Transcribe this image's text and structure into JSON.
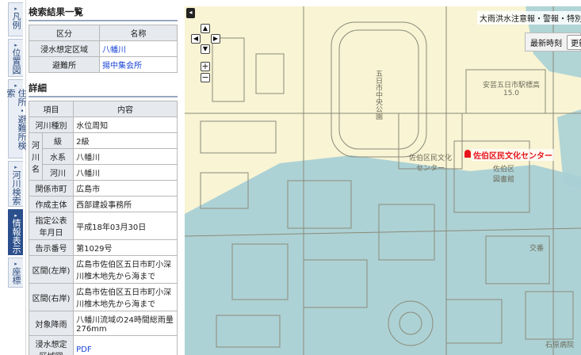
{
  "tabs": [
    {
      "label": "凡例",
      "active": false
    },
    {
      "label": "位置図",
      "active": false
    },
    {
      "label": "住所・避難所検索",
      "active": false
    },
    {
      "label": "河川検索",
      "active": false
    },
    {
      "label": "情報表示",
      "active": true
    },
    {
      "label": "座標",
      "active": false
    }
  ],
  "search_results": {
    "title": "検索結果一覧",
    "headers": [
      "区分",
      "名称"
    ],
    "rows": [
      {
        "category": "浸水想定区域",
        "name": "八幡川"
      },
      {
        "category": "避難所",
        "name": "揚中集会所"
      }
    ]
  },
  "details": {
    "title": "詳細",
    "headers": [
      "項目",
      "内容"
    ],
    "river_type_label": "河川種別",
    "river_type_value": "水位周知",
    "river_name_label": "河川名",
    "grade_label": "級",
    "grade_value": "2級",
    "system_label": "水系",
    "system_value": "八幡川",
    "river_label": "河川",
    "river_value": "八幡川",
    "city_label": "関係市町",
    "city_value": "広島市",
    "author_label": "作成主体",
    "author_value": "西部建設事務所",
    "date_label": "指定公表年月日",
    "date_value": "平成18年03月30日",
    "notice_label": "告示番号",
    "notice_value": "第1029号",
    "left_label": "区間(左岸)",
    "left_value": "広島市佐伯区五日市町小深川椎木地先から海まで",
    "right_label": "区間(右岸)",
    "right_value": "広島市佐伯区五日市町小深川椎木地先から海まで",
    "rain_label": "対象降雨",
    "rain_value": "八幡川流域の24時間総雨量276mm",
    "map_label": "浸水想定区域図",
    "map_value": "PDF"
  },
  "map": {
    "layer_label": "大雨洪水注意報・警報・特別",
    "time_label": "最新時刻",
    "update_label": "更新",
    "facility_label": "佐伯区民文化センター",
    "zoom_in": "+",
    "zoom_out": "−",
    "collapse": "◂",
    "park_label": "五日市中央公園",
    "culture_label": "佐伯区民文化センター",
    "library_label": "佐伯区図書館",
    "monument_label": "安芸五日市駅標高15.0",
    "koban_label": "交番",
    "hospital_label": "石原病院",
    "flood_color": "#a9d0d5",
    "land_color": "#f8f4d4",
    "highlight_color": "#f6e7a0"
  }
}
